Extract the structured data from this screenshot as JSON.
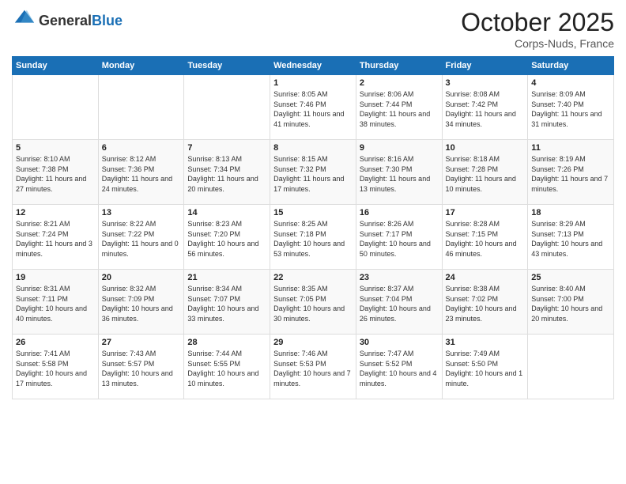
{
  "header": {
    "logo_line1": "General",
    "logo_line2": "Blue",
    "month": "October 2025",
    "location": "Corps-Nuds, France"
  },
  "days_of_week": [
    "Sunday",
    "Monday",
    "Tuesday",
    "Wednesday",
    "Thursday",
    "Friday",
    "Saturday"
  ],
  "weeks": [
    [
      {
        "day": "",
        "sunrise": "",
        "sunset": "",
        "daylight": ""
      },
      {
        "day": "",
        "sunrise": "",
        "sunset": "",
        "daylight": ""
      },
      {
        "day": "",
        "sunrise": "",
        "sunset": "",
        "daylight": ""
      },
      {
        "day": "1",
        "sunrise": "Sunrise: 8:05 AM",
        "sunset": "Sunset: 7:46 PM",
        "daylight": "Daylight: 11 hours and 41 minutes."
      },
      {
        "day": "2",
        "sunrise": "Sunrise: 8:06 AM",
        "sunset": "Sunset: 7:44 PM",
        "daylight": "Daylight: 11 hours and 38 minutes."
      },
      {
        "day": "3",
        "sunrise": "Sunrise: 8:08 AM",
        "sunset": "Sunset: 7:42 PM",
        "daylight": "Daylight: 11 hours and 34 minutes."
      },
      {
        "day": "4",
        "sunrise": "Sunrise: 8:09 AM",
        "sunset": "Sunset: 7:40 PM",
        "daylight": "Daylight: 11 hours and 31 minutes."
      }
    ],
    [
      {
        "day": "5",
        "sunrise": "Sunrise: 8:10 AM",
        "sunset": "Sunset: 7:38 PM",
        "daylight": "Daylight: 11 hours and 27 minutes."
      },
      {
        "day": "6",
        "sunrise": "Sunrise: 8:12 AM",
        "sunset": "Sunset: 7:36 PM",
        "daylight": "Daylight: 11 hours and 24 minutes."
      },
      {
        "day": "7",
        "sunrise": "Sunrise: 8:13 AM",
        "sunset": "Sunset: 7:34 PM",
        "daylight": "Daylight: 11 hours and 20 minutes."
      },
      {
        "day": "8",
        "sunrise": "Sunrise: 8:15 AM",
        "sunset": "Sunset: 7:32 PM",
        "daylight": "Daylight: 11 hours and 17 minutes."
      },
      {
        "day": "9",
        "sunrise": "Sunrise: 8:16 AM",
        "sunset": "Sunset: 7:30 PM",
        "daylight": "Daylight: 11 hours and 13 minutes."
      },
      {
        "day": "10",
        "sunrise": "Sunrise: 8:18 AM",
        "sunset": "Sunset: 7:28 PM",
        "daylight": "Daylight: 11 hours and 10 minutes."
      },
      {
        "day": "11",
        "sunrise": "Sunrise: 8:19 AM",
        "sunset": "Sunset: 7:26 PM",
        "daylight": "Daylight: 11 hours and 7 minutes."
      }
    ],
    [
      {
        "day": "12",
        "sunrise": "Sunrise: 8:21 AM",
        "sunset": "Sunset: 7:24 PM",
        "daylight": "Daylight: 11 hours and 3 minutes."
      },
      {
        "day": "13",
        "sunrise": "Sunrise: 8:22 AM",
        "sunset": "Sunset: 7:22 PM",
        "daylight": "Daylight: 11 hours and 0 minutes."
      },
      {
        "day": "14",
        "sunrise": "Sunrise: 8:23 AM",
        "sunset": "Sunset: 7:20 PM",
        "daylight": "Daylight: 10 hours and 56 minutes."
      },
      {
        "day": "15",
        "sunrise": "Sunrise: 8:25 AM",
        "sunset": "Sunset: 7:18 PM",
        "daylight": "Daylight: 10 hours and 53 minutes."
      },
      {
        "day": "16",
        "sunrise": "Sunrise: 8:26 AM",
        "sunset": "Sunset: 7:17 PM",
        "daylight": "Daylight: 10 hours and 50 minutes."
      },
      {
        "day": "17",
        "sunrise": "Sunrise: 8:28 AM",
        "sunset": "Sunset: 7:15 PM",
        "daylight": "Daylight: 10 hours and 46 minutes."
      },
      {
        "day": "18",
        "sunrise": "Sunrise: 8:29 AM",
        "sunset": "Sunset: 7:13 PM",
        "daylight": "Daylight: 10 hours and 43 minutes."
      }
    ],
    [
      {
        "day": "19",
        "sunrise": "Sunrise: 8:31 AM",
        "sunset": "Sunset: 7:11 PM",
        "daylight": "Daylight: 10 hours and 40 minutes."
      },
      {
        "day": "20",
        "sunrise": "Sunrise: 8:32 AM",
        "sunset": "Sunset: 7:09 PM",
        "daylight": "Daylight: 10 hours and 36 minutes."
      },
      {
        "day": "21",
        "sunrise": "Sunrise: 8:34 AM",
        "sunset": "Sunset: 7:07 PM",
        "daylight": "Daylight: 10 hours and 33 minutes."
      },
      {
        "day": "22",
        "sunrise": "Sunrise: 8:35 AM",
        "sunset": "Sunset: 7:05 PM",
        "daylight": "Daylight: 10 hours and 30 minutes."
      },
      {
        "day": "23",
        "sunrise": "Sunrise: 8:37 AM",
        "sunset": "Sunset: 7:04 PM",
        "daylight": "Daylight: 10 hours and 26 minutes."
      },
      {
        "day": "24",
        "sunrise": "Sunrise: 8:38 AM",
        "sunset": "Sunset: 7:02 PM",
        "daylight": "Daylight: 10 hours and 23 minutes."
      },
      {
        "day": "25",
        "sunrise": "Sunrise: 8:40 AM",
        "sunset": "Sunset: 7:00 PM",
        "daylight": "Daylight: 10 hours and 20 minutes."
      }
    ],
    [
      {
        "day": "26",
        "sunrise": "Sunrise: 7:41 AM",
        "sunset": "Sunset: 5:58 PM",
        "daylight": "Daylight: 10 hours and 17 minutes."
      },
      {
        "day": "27",
        "sunrise": "Sunrise: 7:43 AM",
        "sunset": "Sunset: 5:57 PM",
        "daylight": "Daylight: 10 hours and 13 minutes."
      },
      {
        "day": "28",
        "sunrise": "Sunrise: 7:44 AM",
        "sunset": "Sunset: 5:55 PM",
        "daylight": "Daylight: 10 hours and 10 minutes."
      },
      {
        "day": "29",
        "sunrise": "Sunrise: 7:46 AM",
        "sunset": "Sunset: 5:53 PM",
        "daylight": "Daylight: 10 hours and 7 minutes."
      },
      {
        "day": "30",
        "sunrise": "Sunrise: 7:47 AM",
        "sunset": "Sunset: 5:52 PM",
        "daylight": "Daylight: 10 hours and 4 minutes."
      },
      {
        "day": "31",
        "sunrise": "Sunrise: 7:49 AM",
        "sunset": "Sunset: 5:50 PM",
        "daylight": "Daylight: 10 hours and 1 minute."
      },
      {
        "day": "",
        "sunrise": "",
        "sunset": "",
        "daylight": ""
      }
    ]
  ]
}
